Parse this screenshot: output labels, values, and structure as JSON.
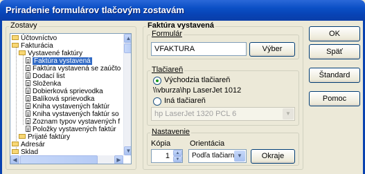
{
  "window": {
    "title": "Priradenie formulárov tlačovým zostavám"
  },
  "left": {
    "group_label": "Zostavy",
    "tree": [
      {
        "label": "Účtovníctvo",
        "type": "folder",
        "level": 0
      },
      {
        "label": "Fakturácia",
        "type": "folder-open",
        "level": 0
      },
      {
        "label": "Vystavené faktúry",
        "type": "folder-open",
        "level": 1
      },
      {
        "label": "Faktúra vystavená",
        "type": "doc",
        "level": 2,
        "selected": true
      },
      {
        "label": "Faktúra vystavená se zaúčto",
        "type": "doc",
        "level": 2
      },
      {
        "label": "Dodací list",
        "type": "doc",
        "level": 2
      },
      {
        "label": "Složenka",
        "type": "doc",
        "level": 2
      },
      {
        "label": "Dobierková sprievodka",
        "type": "doc",
        "level": 2
      },
      {
        "label": "Balíková sprievodka",
        "type": "doc",
        "level": 2
      },
      {
        "label": "Kniha vystavených faktúr",
        "type": "doc",
        "level": 2
      },
      {
        "label": "Kniha vystavených faktúr so",
        "type": "doc",
        "level": 2
      },
      {
        "label": "Zoznam typov vystavených f",
        "type": "doc",
        "level": 2
      },
      {
        "label": "Položky vystavených faktúr",
        "type": "doc",
        "level": 2
      },
      {
        "label": "Prijaté faktúry",
        "type": "folder",
        "level": 1
      },
      {
        "label": "Adresár",
        "type": "folder",
        "level": 0
      },
      {
        "label": "Sklad",
        "type": "folder",
        "level": 0
      }
    ]
  },
  "right": {
    "section_title": "Faktúra vystavená",
    "form_group": {
      "label": "Formulár",
      "value": "VFAKTURA",
      "button": "Výber"
    },
    "printer_group": {
      "label": "Tlačiareň",
      "default_option": "Východzia tlačiareň",
      "default_path": "\\\\vburza\\hp LaserJet 1012",
      "other_option": "Iná tlačiareň",
      "other_value": "hp LaserJet 1320 PCL 6"
    },
    "settings_group": {
      "label": "Nastavenie",
      "copies_label": "Kópia",
      "copies_value": "1",
      "orientation_label": "Orientácia",
      "orientation_value": "Podľa tlačiarn",
      "margins_button": "Okraje"
    }
  },
  "buttons": {
    "ok": "OK",
    "back": "Späť",
    "standard": "Štandard",
    "help": "Pomoc"
  }
}
